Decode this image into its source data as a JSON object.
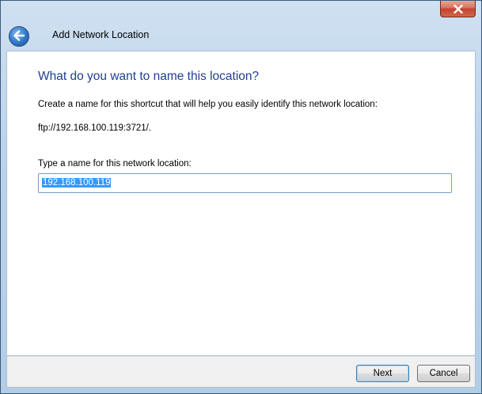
{
  "window": {
    "title": "Add Network Location"
  },
  "titlebar": {
    "close_icon": "close-icon",
    "back_icon": "back-arrow-icon"
  },
  "content": {
    "heading": "What do you want to name this location?",
    "description": "Create a name for this shortcut that will help you easily identify this network location:",
    "location_url": "ftp://192.168.100.119:3721/.",
    "name_label": "Type a name for this network location:",
    "name_value": "192.168.100.119"
  },
  "footer": {
    "next_label": "Next",
    "cancel_label": "Cancel"
  },
  "colors": {
    "heading": "#1f3f8f",
    "selection": "#3399ff",
    "close_button": "#c4432c",
    "frame": "#bcd3ea"
  }
}
